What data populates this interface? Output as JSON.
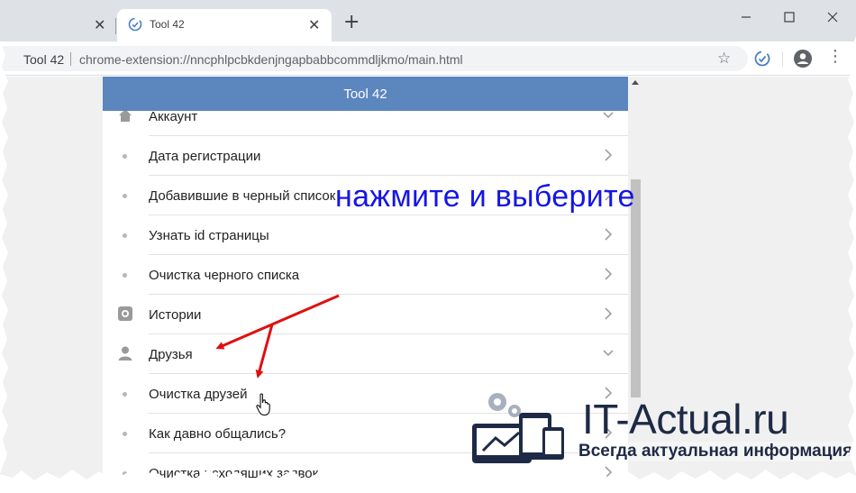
{
  "browser": {
    "tabs": [
      {
        "title": "",
        "active": false
      },
      {
        "title": "Tool 42",
        "active": true
      }
    ],
    "new_tab_label": "+",
    "address": {
      "site_chip": "Tool 42",
      "url": "chrome-extension://nncphlpcbkdenjngapbabbcommdljkmo/main.html"
    },
    "icons": {
      "bookmark": "star-icon",
      "extension": "tool42-extension-icon",
      "profile": "profile-icon",
      "menu": "kebab-menu-icon"
    }
  },
  "panel": {
    "title": "Tool 42",
    "items": [
      {
        "label": "Аккаунт",
        "icon": "home-icon",
        "chevron": "down"
      },
      {
        "label": "Дата регистрации",
        "icon": "bullet",
        "chevron": "right"
      },
      {
        "label": "Добавившие в черный список",
        "icon": "bullet",
        "chevron": "right"
      },
      {
        "label": "Узнать id страницы",
        "icon": "bullet",
        "chevron": "right"
      },
      {
        "label": "Очистка черного списка",
        "icon": "bullet",
        "chevron": "right"
      },
      {
        "label": "Истории",
        "icon": "stories-icon",
        "chevron": "right"
      },
      {
        "label": "Друзья",
        "icon": "person-icon",
        "chevron": "down"
      },
      {
        "label": "Очистка друзей",
        "icon": "bullet",
        "chevron": "right"
      },
      {
        "label": "Как давно общались?",
        "icon": "bullet",
        "chevron": "right"
      },
      {
        "label": "Очистка исходящих заявок",
        "icon": "bullet",
        "chevron": "right"
      }
    ]
  },
  "annotation": {
    "text": "нажмите и выберите",
    "color": "#1515e6",
    "arrow_color": "#e01010"
  },
  "watermark": {
    "brand": "IT-Actual.ru",
    "tagline": "Всегда актуальная информация"
  },
  "colors": {
    "header": "#5b86be",
    "tabstrip": "#dee1e6"
  }
}
